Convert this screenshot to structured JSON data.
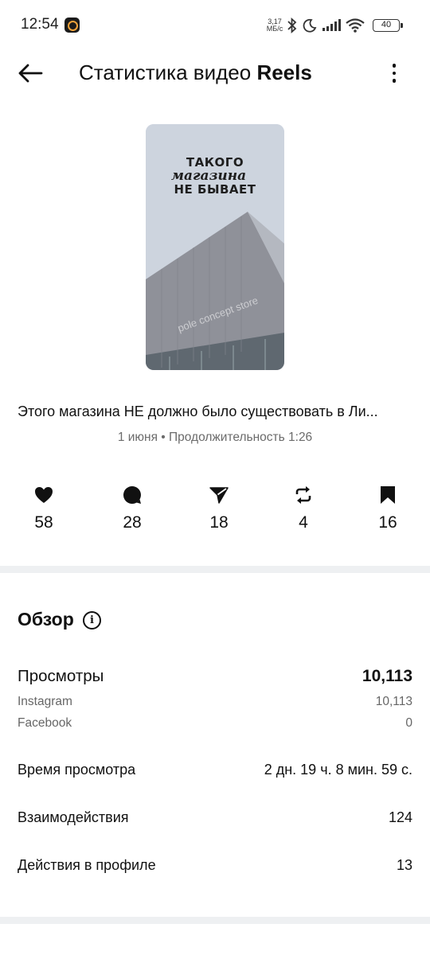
{
  "status_bar": {
    "time": "12:54",
    "network_speed_value": "3,17",
    "network_speed_unit": "МБ/с",
    "battery": "40",
    "icons": [
      "bluetooth-icon",
      "moon-icon",
      "signal-icon",
      "wifi-icon",
      "battery-icon"
    ]
  },
  "header": {
    "title_regular": "Статистика видео ",
    "title_bold": "Reels",
    "icons": [
      "back-arrow-icon",
      "more-vertical-icon"
    ]
  },
  "thumbnail": {
    "line1": "ТАКОГО",
    "line2": "магазина",
    "line3": "НЕ БЫВАЕТ",
    "store_text": "pole concept store"
  },
  "post": {
    "caption": "Этого магазина НЕ должно было существовать в Ли...",
    "meta": "1 июня • Продолжительность 1:26"
  },
  "engagement": [
    {
      "icon": "heart-icon",
      "value": "58"
    },
    {
      "icon": "comment-icon",
      "value": "28"
    },
    {
      "icon": "share-icon",
      "value": "18"
    },
    {
      "icon": "repost-icon",
      "value": "4"
    },
    {
      "icon": "bookmark-icon",
      "value": "16"
    }
  ],
  "overview": {
    "title": "Обзор",
    "views_label": "Просмотры",
    "views_value": "10,113",
    "instagram_label": "Instagram",
    "instagram_value": "10,113",
    "facebook_label": "Facebook",
    "facebook_value": "0",
    "watch_time_label": "Время просмотра",
    "watch_time_value": "2 дн. 19 ч. 8 мин. 59 с.",
    "interactions_label": "Взаимодействия",
    "interactions_value": "124",
    "profile_actions_label": "Действия в профиле",
    "profile_actions_value": "13"
  },
  "colors": {
    "background": "#ffffff",
    "divider": "#eef0f2",
    "secondary_text": "#6b6b6b",
    "thumb_sky": "#cdd4de",
    "thumb_building": "#8f9199"
  }
}
